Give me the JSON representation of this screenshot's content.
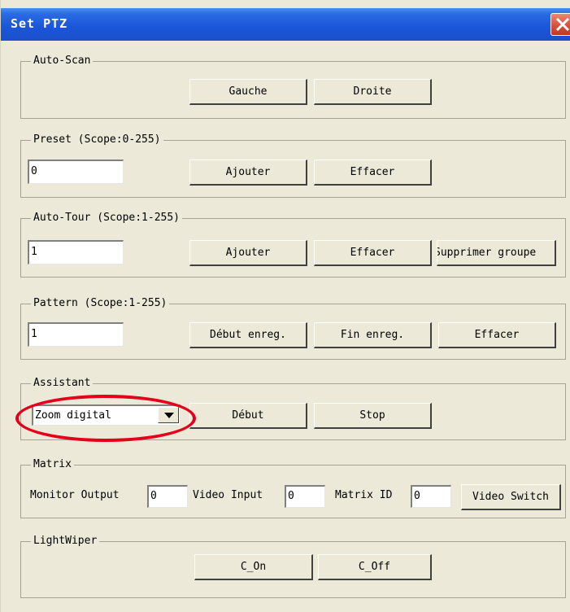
{
  "window": {
    "title": "Set PTZ"
  },
  "auto_scan": {
    "label": "Auto-Scan",
    "left_button": "Gauche",
    "right_button": "Droite"
  },
  "preset": {
    "label": "Preset (Scope:0-255)",
    "value": "0",
    "add_button": "Ajouter",
    "delete_button": "Effacer"
  },
  "auto_tour": {
    "label": "Auto-Tour (Scope:1-255)",
    "value": "1",
    "add_button": "Ajouter",
    "delete_button": "Effacer",
    "delete_group_button": "Supprimer groupe"
  },
  "pattern": {
    "label": "Pattern (Scope:1-255)",
    "value": "1",
    "start_button": "Début enreg.",
    "end_button": "Fin enreg.",
    "delete_button": "Effacer"
  },
  "assistant": {
    "label": "Assistant",
    "selected": "Zoom digital",
    "start_button": "Début",
    "stop_button": "Stop"
  },
  "matrix": {
    "label": "Matrix",
    "monitor_output_label": "Monitor Output",
    "monitor_output_value": "0",
    "video_input_label": "Video Input",
    "video_input_value": "0",
    "matrix_id_label": "Matrix ID",
    "matrix_id_value": "0",
    "video_switch_button": "Video Switch"
  },
  "light_wiper": {
    "label": "LightWiper",
    "on_button": "C_On",
    "off_button": "C_Off"
  },
  "colors": {
    "title_bar": "#1b4fcc",
    "dialog_bg": "#ece9d8",
    "highlight_circle": "#e4001b",
    "close_button": "#d8513a"
  }
}
